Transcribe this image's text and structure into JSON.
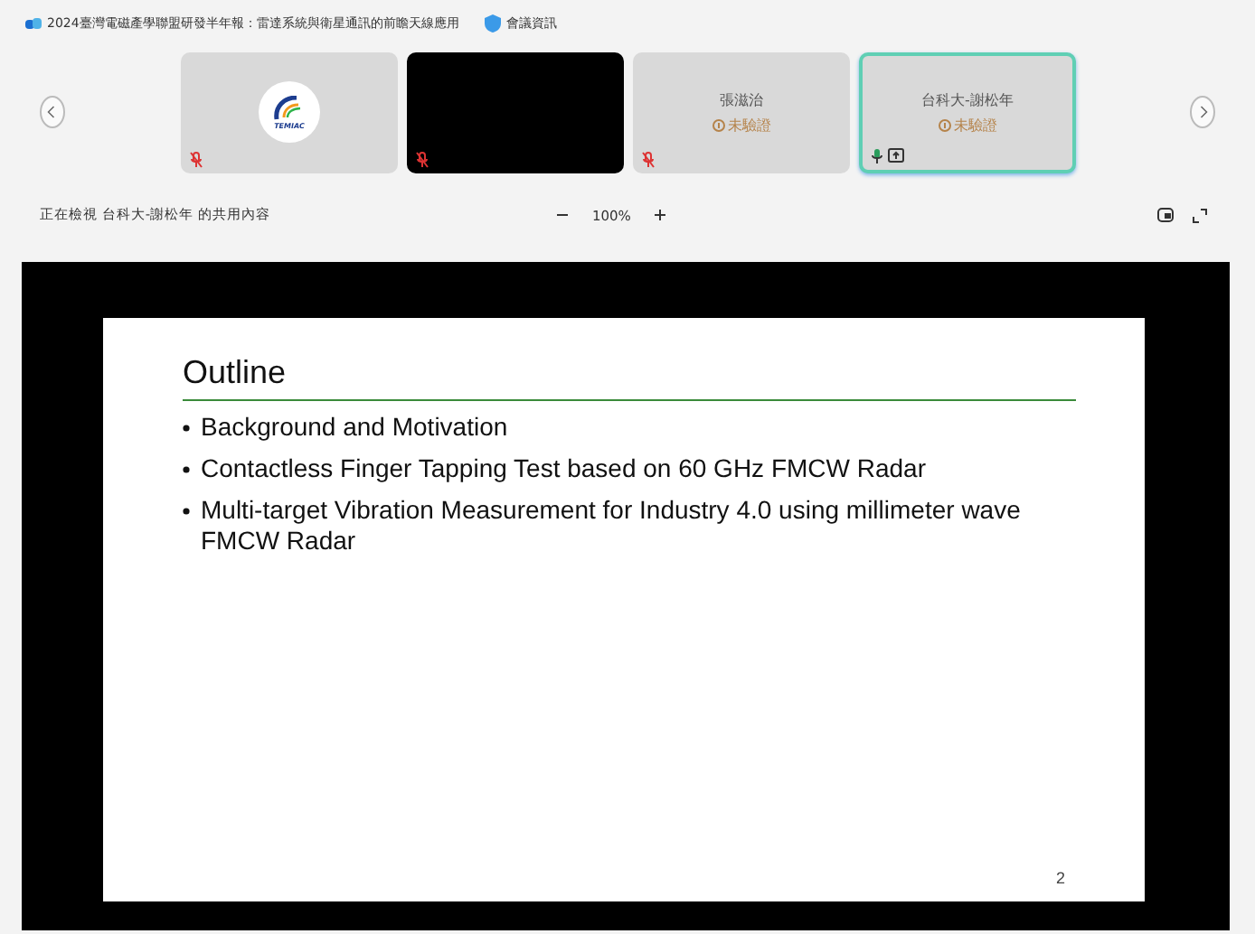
{
  "window": {
    "title": "2024臺灣電磁產學聯盟研發半年報：雷達系統與衛星通訊的前瞻天線應用",
    "meeting_info": "會議資訊"
  },
  "participants": [
    {
      "kind": "logo",
      "logo_text": "TEMIAC",
      "muted": true,
      "selected": false
    },
    {
      "kind": "video",
      "muted": true,
      "selected": false
    },
    {
      "kind": "name",
      "name": "張滋治",
      "status": "未驗證",
      "muted": true,
      "selected": false
    },
    {
      "kind": "name",
      "name": "台科大-謝松年",
      "status": "未驗證",
      "muted": false,
      "selected": true
    }
  ],
  "share_bar": {
    "viewing": "正在檢視 台科大-謝松年 的共用內容",
    "zoom": "100%"
  },
  "slide": {
    "title": "Outline",
    "bullets": [
      "Background and Motivation",
      "Contactless Finger Tapping Test based on 60 GHz FMCW Radar",
      "Multi-target Vibration Measurement for Industry 4.0 using millimeter wave FMCW Radar"
    ],
    "page": "2"
  }
}
